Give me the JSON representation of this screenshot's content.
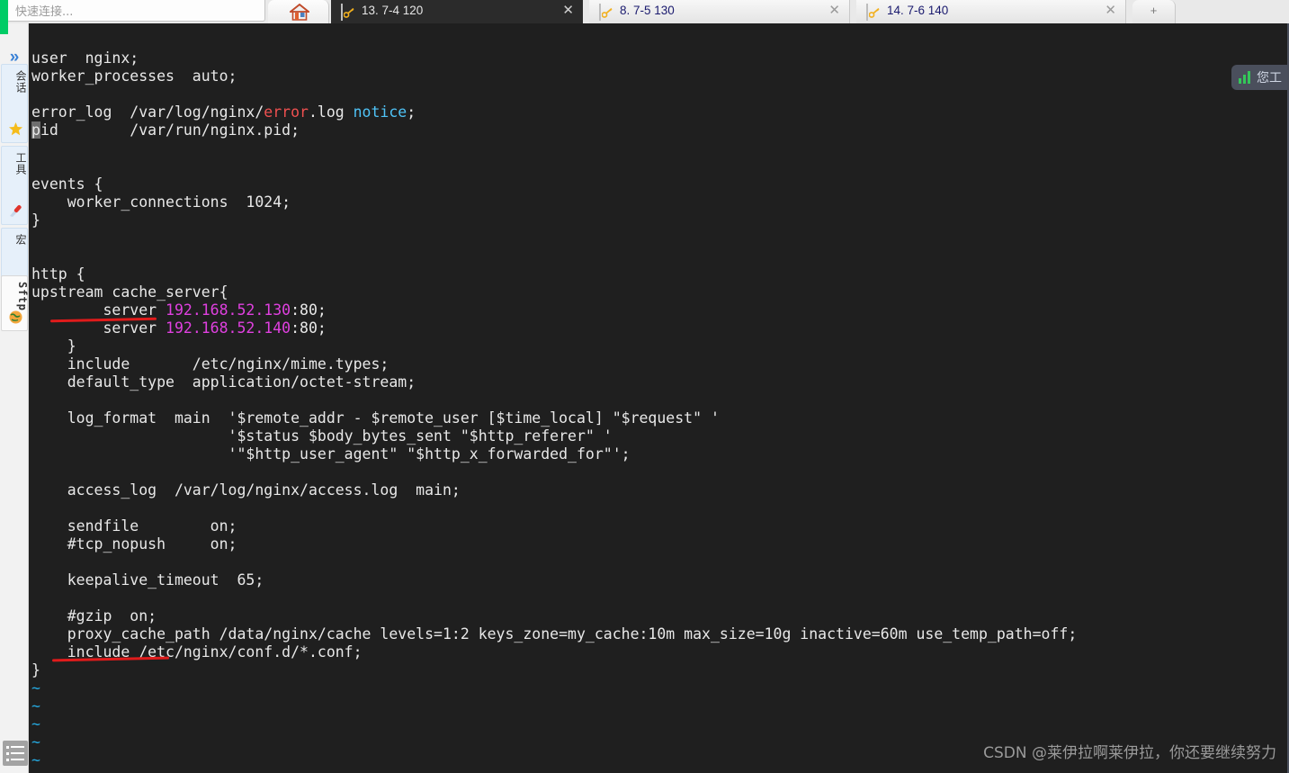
{
  "app": {
    "quick_connect_placeholder": "快速连接...",
    "watermark": "CSDN @莱伊拉啊莱伊拉，你还要继续努力"
  },
  "tabs": [
    {
      "id": "home",
      "label": "",
      "icon": "home-icon",
      "active": false,
      "closable": false
    },
    {
      "id": "tab-13",
      "label": "13. 7-4 120",
      "icon": "key-icon",
      "active": true,
      "closable": true
    },
    {
      "id": "tab-8",
      "label": "8. 7-5 130",
      "icon": "key-icon",
      "active": false,
      "closable": true
    },
    {
      "id": "tab-14",
      "label": "14. 7-6 140",
      "icon": "key-icon",
      "active": false,
      "closable": true
    },
    {
      "id": "new-tab",
      "label": "+",
      "icon": "plus-icon",
      "active": false,
      "closable": false
    }
  ],
  "sidebar": {
    "expand_glyph": "»",
    "items": [
      {
        "id": "session",
        "label": "会话",
        "icon": "star-icon",
        "selected": false
      },
      {
        "id": "tools",
        "label": "工具",
        "icon": "knife-icon",
        "selected": false
      },
      {
        "id": "macro",
        "label": "宏",
        "icon": "paper-plane-icon",
        "selected": false
      },
      {
        "id": "sftp",
        "label": "Sftp",
        "icon": "globe-icon",
        "selected": true
      }
    ],
    "list_icon": "list-icon"
  },
  "status_pill": {
    "icon": "signal-bars-icon",
    "text": "您工",
    "accent": "#34c759",
    "background": "#4a4f5c"
  },
  "terminal": {
    "background": "#1f1f1f",
    "foreground": "#e8e8e8",
    "filename_hint": "nginx.conf",
    "cursor_char": "p",
    "lines": [
      "user  nginx;",
      "worker_processes  auto;",
      "",
      "error_log  /var/log/nginx/error.log notice;",
      "pid        /var/run/nginx.pid;",
      "",
      "",
      "events {",
      "    worker_connections  1024;",
      "}",
      "",
      "",
      "http {",
      "upstream cache_server{",
      "        server 192.168.52.130:80;",
      "        server 192.168.52.140:80;",
      "    }",
      "    include       /etc/nginx/mime.types;",
      "    default_type  application/octet-stream;",
      "",
      "    log_format  main  '$remote_addr - $remote_user [$time_local] \"$request\" '",
      "                      '$status $body_bytes_sent \"$http_referer\" '",
      "                      '\"$http_user_agent\" \"$http_x_forwarded_for\"';",
      "",
      "    access_log  /var/log/nginx/access.log  main;",
      "",
      "    sendfile        on;",
      "    #tcp_nopush     on;",
      "",
      "    keepalive_timeout  65;",
      "",
      "    #gzip  on;",
      "    proxy_cache_path /data/nginx/cache levels=1:2 keys_zone=my_cache:10m max_size=10g inactive=60m use_temp_path=off;",
      "    include /etc/nginx/conf.d/*.conf;",
      "}",
      "~",
      "~",
      "~",
      "~",
      "~"
    ],
    "syntax_colors": {
      "error_token": "#f05050",
      "notice_token": "#4fc3f7",
      "ip_address": "#e040e0",
      "tilde": "#25a9e0"
    },
    "annotations": [
      {
        "id": "upstream-underline",
        "color": "#e01b1b",
        "target": "upstream"
      },
      {
        "id": "proxy-cache-underline",
        "color": "#e01b1b",
        "target": "proxy_cache_path"
      }
    ]
  }
}
